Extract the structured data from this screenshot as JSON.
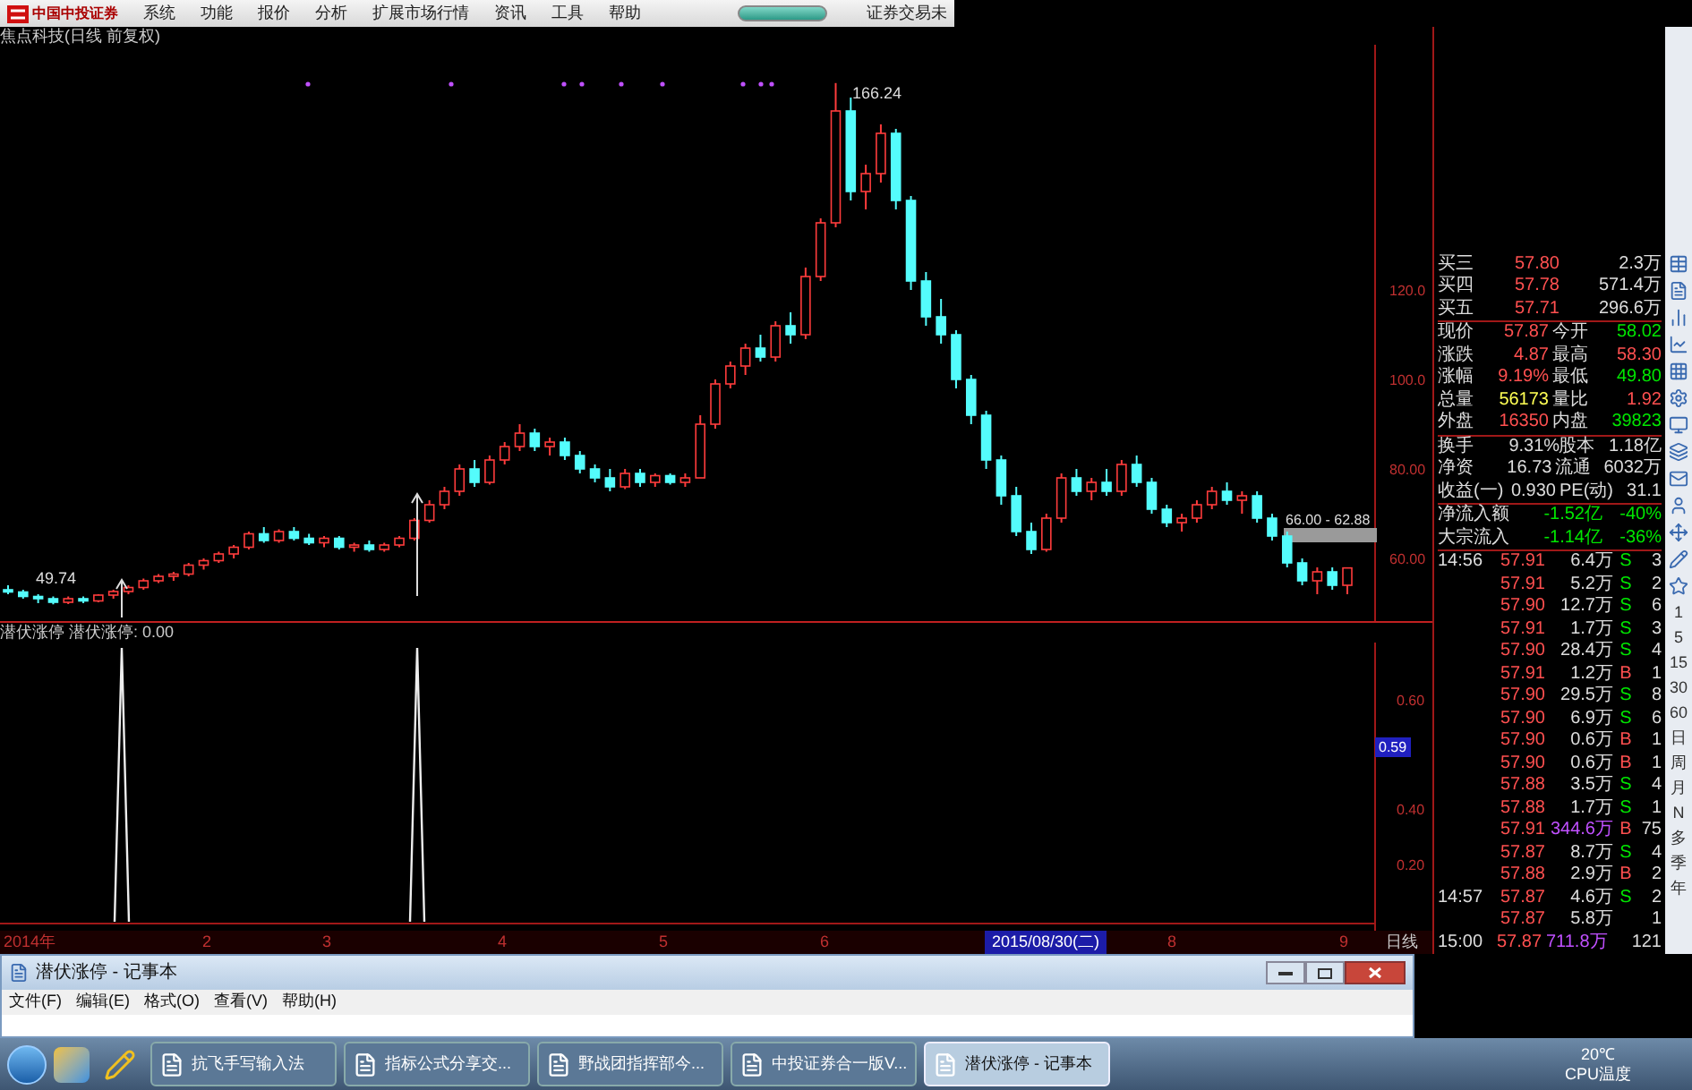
{
  "menu_bar": {
    "logo_text": "中国中投证券",
    "menu_items": [
      "系统",
      "功能",
      "报价",
      "分析",
      "扩展市场行情",
      "资讯",
      "工具",
      "帮助"
    ],
    "status_text": "证券交易未"
  },
  "chart": {
    "title": "焦点科技(日线 前复权)",
    "high_label": "166.24",
    "low_label": "49.74",
    "range_label": "66.00 - 62.88",
    "chart_data": {
      "type": "candlestick",
      "ylim": [
        46,
        174.8
      ],
      "ohlc": [
        [
          53,
          54,
          52,
          52.5
        ],
        [
          52.5,
          53,
          51,
          51.5
        ],
        [
          51.5,
          52,
          50,
          51
        ],
        [
          51,
          51.5,
          49.74,
          50.2
        ],
        [
          50.2,
          51.5,
          49.8,
          51
        ],
        [
          51,
          51.5,
          50,
          50.5
        ],
        [
          50.5,
          52,
          50.2,
          51.8
        ],
        [
          51.8,
          53,
          51,
          52.6
        ],
        [
          52.6,
          54,
          52,
          53.5
        ],
        [
          53.5,
          55.5,
          53,
          55
        ],
        [
          55,
          56.5,
          54.5,
          56
        ],
        [
          56,
          57,
          55,
          56.5
        ],
        [
          56.5,
          59,
          56,
          58.5
        ],
        [
          58.5,
          60,
          57.5,
          59.5
        ],
        [
          59.5,
          61.5,
          59,
          61
        ],
        [
          61,
          63,
          60,
          62.5
        ],
        [
          62.5,
          66,
          62,
          65.5
        ],
        [
          65.5,
          67,
          63.5,
          64
        ],
        [
          64,
          66.5,
          63.5,
          66
        ],
        [
          66,
          67,
          64,
          64.5
        ],
        [
          64.5,
          65.5,
          63,
          63.5
        ],
        [
          63.5,
          65,
          62.5,
          64.5
        ],
        [
          64.5,
          65,
          62,
          62.5
        ],
        [
          62.5,
          63.5,
          61.5,
          63
        ],
        [
          63,
          64,
          61.5,
          62
        ],
        [
          62,
          63.5,
          61.5,
          63
        ],
        [
          63,
          65,
          62.5,
          64.5
        ],
        [
          64.5,
          69,
          64,
          68.5
        ],
        [
          68.5,
          73,
          68,
          72
        ],
        [
          72,
          76,
          71,
          75
        ],
        [
          75,
          81,
          74,
          80
        ],
        [
          80,
          82,
          76,
          77
        ],
        [
          77,
          83,
          76.5,
          82
        ],
        [
          82,
          86,
          81,
          85
        ],
        [
          85,
          90,
          84,
          88
        ],
        [
          88,
          89,
          84,
          85
        ],
        [
          85,
          87,
          83,
          86
        ],
        [
          86,
          87,
          82,
          83
        ],
        [
          83,
          84,
          79,
          80
        ],
        [
          80,
          81,
          77,
          78
        ],
        [
          78,
          80,
          75,
          76
        ],
        [
          76,
          80,
          75.5,
          79
        ],
        [
          79,
          80,
          76,
          77
        ],
        [
          77,
          79,
          76,
          78.5
        ],
        [
          78.5,
          79,
          76.5,
          77
        ],
        [
          77,
          79,
          76,
          78
        ],
        [
          78,
          92,
          78,
          90
        ],
        [
          90,
          100,
          89,
          99
        ],
        [
          99,
          104,
          98,
          103
        ],
        [
          103,
          108,
          101,
          107
        ],
        [
          107,
          110,
          104,
          105
        ],
        [
          105,
          113,
          104,
          112
        ],
        [
          112,
          115,
          108,
          110
        ],
        [
          110,
          125,
          109,
          123
        ],
        [
          123,
          136,
          122,
          135
        ],
        [
          135,
          166.24,
          134,
          160
        ],
        [
          160,
          163,
          140,
          142
        ],
        [
          142,
          148,
          138,
          146
        ],
        [
          146,
          157,
          144,
          155
        ],
        [
          155,
          156,
          138,
          140
        ],
        [
          140,
          141,
          120,
          122
        ],
        [
          122,
          124,
          112,
          114
        ],
        [
          114,
          118,
          108,
          110
        ],
        [
          110,
          111,
          98,
          100
        ],
        [
          100,
          101,
          90,
          92
        ],
        [
          92,
          93,
          80,
          82
        ],
        [
          82,
          83,
          72,
          74
        ],
        [
          74,
          76,
          65,
          66
        ],
        [
          66,
          68,
          61,
          62
        ],
        [
          62,
          70,
          61.5,
          69
        ],
        [
          69,
          79,
          68,
          78
        ],
        [
          78,
          80,
          74,
          75
        ],
        [
          75,
          78,
          73,
          77
        ],
        [
          77,
          80,
          74,
          75
        ],
        [
          75,
          82,
          74,
          81
        ],
        [
          81,
          83,
          76,
          77
        ],
        [
          77,
          78,
          70,
          71
        ],
        [
          71,
          72,
          67,
          68
        ],
        [
          68,
          70,
          66,
          69
        ],
        [
          69,
          73,
          68,
          72
        ],
        [
          72,
          76,
          71,
          75
        ],
        [
          75,
          77,
          72,
          73
        ],
        [
          73,
          75,
          70,
          74
        ],
        [
          74,
          75,
          68,
          69
        ],
        [
          69,
          70,
          64,
          65
        ],
        [
          65,
          66,
          58,
          59
        ],
        [
          59,
          60,
          54,
          55
        ],
        [
          55,
          58,
          52,
          57
        ],
        [
          57,
          58,
          53,
          54
        ],
        [
          54,
          58,
          52,
          57.87
        ]
      ],
      "yticks": [
        {
          "value": 120,
          "label": "120.0"
        },
        {
          "value": 100,
          "label": "100.0"
        },
        {
          "value": 80,
          "label": "80.00"
        },
        {
          "value": 60,
          "label": "60.00"
        }
      ]
    }
  },
  "indicator": {
    "title": "潜伏涨停 潜伏涨停: 0.00",
    "axis_labels": [
      "0.60",
      "0.40",
      "0.20"
    ],
    "cursor_value": "0.59"
  },
  "time_axis": {
    "labels": [
      {
        "text": "2014年",
        "kind": "tick"
      },
      {
        "text": "2",
        "kind": "tick"
      },
      {
        "text": "3",
        "kind": "tick"
      },
      {
        "text": "4",
        "kind": "tick"
      },
      {
        "text": "5",
        "kind": "tick"
      },
      {
        "text": "6",
        "kind": "tick"
      },
      {
        "text": "2015/08/30(二)",
        "kind": "cursor"
      },
      {
        "text": "8",
        "kind": "tick"
      },
      {
        "text": "9",
        "kind": "tick"
      }
    ],
    "period": "日线"
  },
  "quote": {
    "bids": [
      {
        "label": "买三",
        "price": "57.80",
        "volume": "2.3万"
      },
      {
        "label": "买四",
        "price": "57.78",
        "volume": "571.4万"
      },
      {
        "label": "买五",
        "price": "57.71",
        "volume": "296.6万"
      }
    ],
    "stats": [
      {
        "cells": [
          {
            "label": "现价",
            "value": "57.87",
            "color": "#ff5050"
          },
          {
            "label": "今开",
            "value": "58.02",
            "color": "#00e600"
          }
        ]
      },
      {
        "cells": [
          {
            "label": "涨跌",
            "value": "4.87",
            "color": "#ff5050"
          },
          {
            "label": "最高",
            "value": "58.30",
            "color": "#ff5050"
          }
        ]
      },
      {
        "cells": [
          {
            "label": "涨幅",
            "value": "9.19%",
            "color": "#ff5050"
          },
          {
            "label": "最低",
            "value": "49.80",
            "color": "#00e600"
          }
        ]
      },
      {
        "cells": [
          {
            "label": "总量",
            "value": "56173",
            "color": "#ffff54"
          },
          {
            "label": "量比",
            "value": "1.92",
            "color": "#ff5050"
          }
        ]
      },
      {
        "cells": [
          {
            "label": "外盘",
            "value": "16350",
            "color": "#ff5050"
          },
          {
            "label": "内盘",
            "value": "39823",
            "color": "#00e600"
          }
        ]
      }
    ],
    "fundamentals": [
      {
        "label": "换手",
        "value": "9.31%",
        "label2": "股本",
        "value2": "1.18亿"
      },
      {
        "label": "净资",
        "value": "16.73",
        "label2": "流通",
        "value2": "6032万"
      },
      {
        "label": "收益(一)",
        "value": "0.930",
        "label2": "PE(动)",
        "value2": "31.1"
      }
    ],
    "flows": [
      {
        "label": "净流入额",
        "value": "-1.52亿",
        "percent": "-40%",
        "color": "#00e600"
      },
      {
        "label": "大宗流入",
        "value": "-1.14亿",
        "percent": "-36%",
        "color": "#00e600"
      }
    ],
    "ticks": [
      {
        "time": "14:56",
        "price": "57.91",
        "volume": "6.4万",
        "side": "S",
        "kind": "sell",
        "count": "3",
        "large": false
      },
      {
        "price": "57.91",
        "volume": "5.2万",
        "side": "S",
        "kind": "sell",
        "count": "2",
        "large": false
      },
      {
        "price": "57.90",
        "volume": "12.7万",
        "side": "S",
        "kind": "sell",
        "count": "6",
        "large": false
      },
      {
        "price": "57.91",
        "volume": "1.7万",
        "side": "S",
        "kind": "sell",
        "count": "3",
        "large": false
      },
      {
        "price": "57.90",
        "volume": "28.4万",
        "side": "S",
        "kind": "sell",
        "count": "4",
        "large": false
      },
      {
        "price": "57.91",
        "volume": "1.2万",
        "side": "B",
        "kind": "buy",
        "count": "1",
        "large": false
      },
      {
        "price": "57.90",
        "volume": "29.5万",
        "side": "S",
        "kind": "sell",
        "count": "8",
        "large": false
      },
      {
        "price": "57.90",
        "volume": "6.9万",
        "side": "S",
        "kind": "sell",
        "count": "6",
        "large": false
      },
      {
        "price": "57.90",
        "volume": "0.6万",
        "side": "B",
        "kind": "buy",
        "count": "1",
        "large": false
      },
      {
        "price": "57.90",
        "volume": "0.6万",
        "side": "B",
        "kind": "buy",
        "count": "1",
        "large": false
      },
      {
        "price": "57.88",
        "volume": "3.5万",
        "side": "S",
        "kind": "sell",
        "count": "4",
        "large": false
      },
      {
        "price": "57.88",
        "volume": "1.7万",
        "side": "S",
        "kind": "sell",
        "count": "1",
        "large": false
      },
      {
        "price": "57.91",
        "volume": "344.6万",
        "side": "B",
        "kind": "buy",
        "count": "75",
        "large": true
      },
      {
        "price": "57.87",
        "volume": "8.7万",
        "side": "S",
        "kind": "sell",
        "count": "4",
        "large": false
      },
      {
        "price": "57.88",
        "volume": "2.9万",
        "side": "B",
        "kind": "buy",
        "count": "2",
        "large": false
      },
      {
        "time": "14:57",
        "price": "57.87",
        "volume": "4.6万",
        "side": "S",
        "kind": "sell",
        "count": "2",
        "large": false
      },
      {
        "price": "57.87",
        "volume": "5.8万",
        "count": "1",
        "large": false
      },
      {
        "time": "15:00",
        "price": "57.87",
        "volume": "711.8万",
        "count": "121",
        "large": true
      }
    ]
  },
  "side_toolbar": {
    "periods": [
      "1",
      "5",
      "15",
      "30",
      "60",
      "日",
      "周",
      "月",
      "N",
      "多",
      "季",
      "年"
    ]
  },
  "notepad": {
    "title": "潜伏涨停 - 记事本",
    "menu_items": [
      "文件(F)",
      "编辑(E)",
      "格式(O)",
      "查看(V)",
      "帮助(H)"
    ]
  },
  "taskbar": {
    "tasks": [
      {
        "label": "抗飞手写输入法",
        "selected": false
      },
      {
        "label": "指标公式分享交...",
        "selected": false
      },
      {
        "label": "野战团指挥部今...",
        "selected": false
      },
      {
        "label": "中投证券合一版V...",
        "selected": false
      },
      {
        "label": "潜伏涨停 - 记事本",
        "selected": true
      }
    ],
    "temperature": "20℃",
    "tray_label": "CPU温度"
  }
}
